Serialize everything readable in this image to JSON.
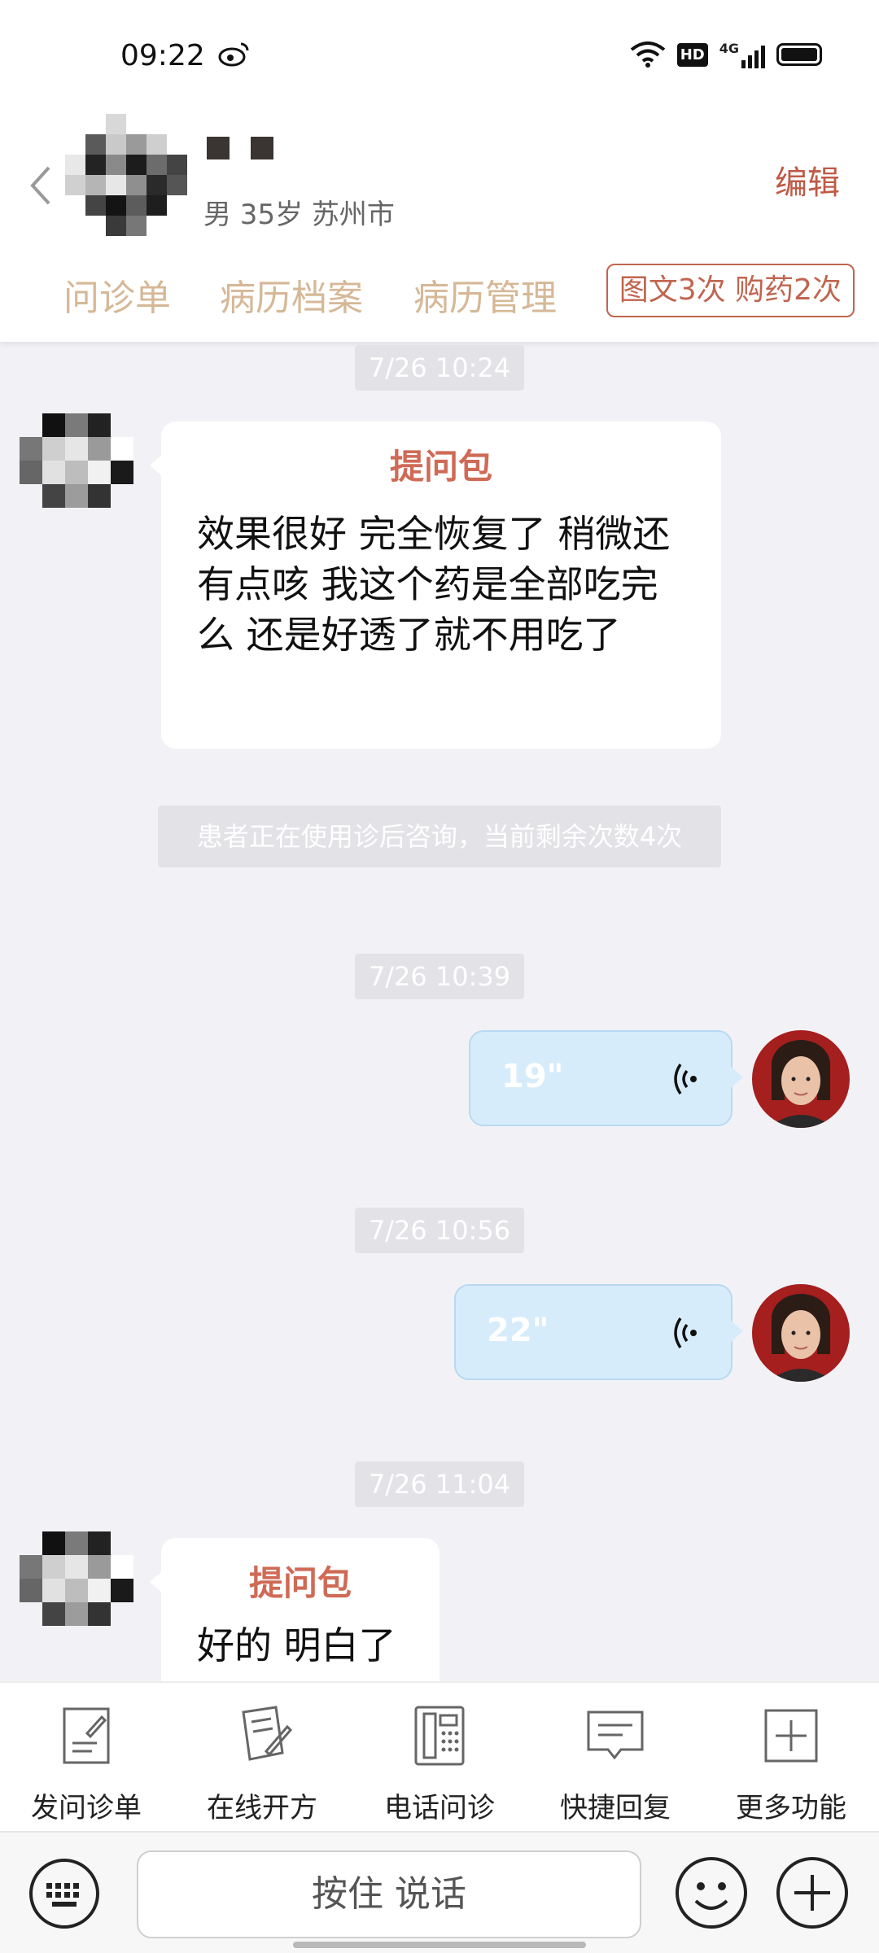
{
  "status_bar": {
    "time": "09:22",
    "icons": [
      "weibo-icon",
      "wifi-icon",
      "hd-icon",
      "signal-4g-icon",
      "battery-icon"
    ],
    "hd_label": "HD",
    "network_label": "4G"
  },
  "header": {
    "patient_info": "男 35岁  苏州市",
    "edit_label": "编辑",
    "tabs": [
      "问诊单",
      "病历档案",
      "病历管理"
    ],
    "badge": "图文3次 购药2次"
  },
  "chat": {
    "messages": [
      {
        "type": "timestamp",
        "text": "7/26 10:24"
      },
      {
        "type": "patient",
        "title": "提问包",
        "text": "效果很好 完全恢复了 稍微还有点咳  我这个药是全部吃完么 还是好透了就不用吃了"
      },
      {
        "type": "notice",
        "text": "患者正在使用诊后咨询，当前剩余次数4次"
      },
      {
        "type": "timestamp",
        "text": "7/26 10:39"
      },
      {
        "type": "doctor_voice",
        "duration": "19\""
      },
      {
        "type": "timestamp",
        "text": "7/26 10:56"
      },
      {
        "type": "doctor_voice",
        "duration": "22\""
      },
      {
        "type": "timestamp",
        "text": "7/26 11:04"
      },
      {
        "type": "patient",
        "title": "提问包",
        "text": "好的 明白了"
      }
    ]
  },
  "toolbar": {
    "items": [
      {
        "label": "发问诊单",
        "icon": "form-icon"
      },
      {
        "label": "在线开方",
        "icon": "prescription-icon"
      },
      {
        "label": "电话问诊",
        "icon": "phone-icon"
      },
      {
        "label": "快捷回复",
        "icon": "quick-reply-icon"
      },
      {
        "label": "更多功能",
        "icon": "more-icon"
      }
    ]
  },
  "input": {
    "hold_to_talk": "按住 说话"
  },
  "colors": {
    "accent": "#c05a45",
    "tab_text": "#d6b897",
    "voice_bubble": "#d7ecfb",
    "chat_bg": "#f2f2f6"
  }
}
